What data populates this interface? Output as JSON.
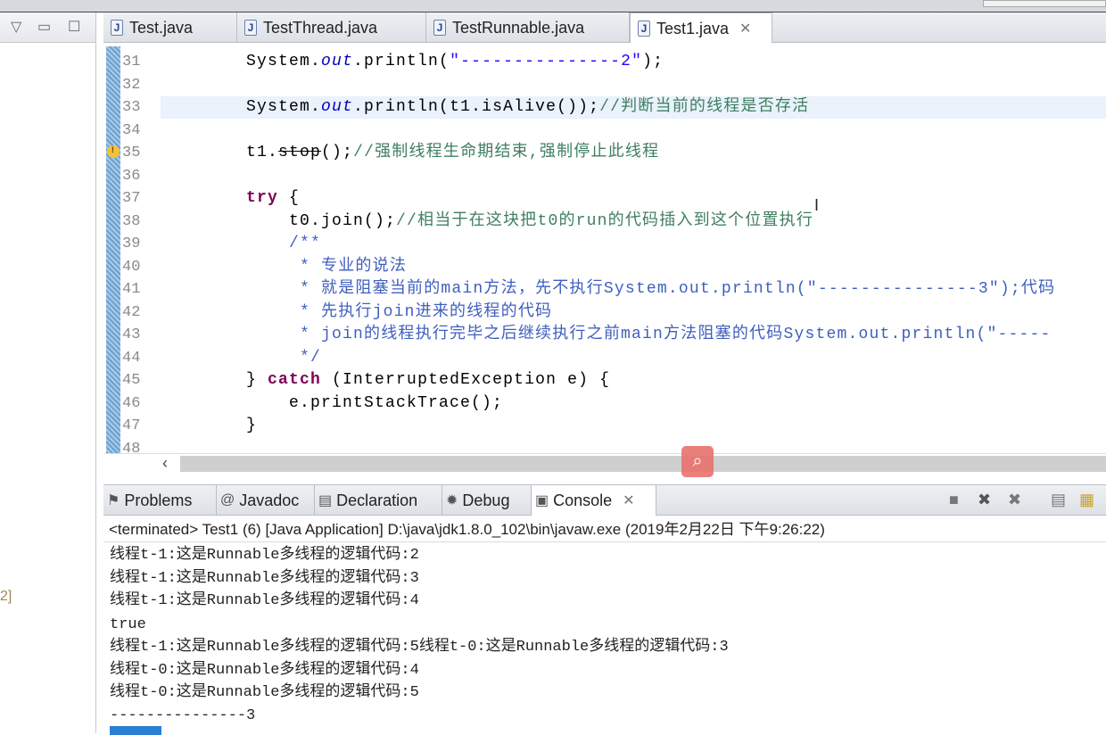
{
  "tabs": [
    {
      "label": "Test.java"
    },
    {
      "label": "TestThread.java"
    },
    {
      "label": "TestRunnable.java"
    },
    {
      "label": "Test1.java",
      "active": true
    }
  ],
  "left_panel": {
    "hint": "2]"
  },
  "editor": {
    "lines": [
      {
        "n": "31",
        "segs": [
          {
            "t": "        System.",
            "c": ""
          },
          {
            "t": "out",
            "c": "fld"
          },
          {
            "t": ".println(",
            "c": ""
          },
          {
            "t": "\"---------------2\"",
            "c": "str"
          },
          {
            "t": ");",
            "c": ""
          }
        ]
      },
      {
        "n": "32",
        "segs": []
      },
      {
        "n": "33",
        "hl": true,
        "segs": [
          {
            "t": "        System.",
            "c": ""
          },
          {
            "t": "out",
            "c": "fld"
          },
          {
            "t": ".println(t1.isAlive());",
            "c": ""
          },
          {
            "t": "//判断当前的线程是否存活",
            "c": "cmt"
          }
        ]
      },
      {
        "n": "34",
        "segs": []
      },
      {
        "n": "35",
        "warn": true,
        "segs": [
          {
            "t": "        t1.",
            "c": ""
          },
          {
            "t": "stop",
            "c": "dep"
          },
          {
            "t": "();",
            "c": ""
          },
          {
            "t": "//强制线程生命期结束,强制停止此线程",
            "c": "cmt"
          }
        ]
      },
      {
        "n": "36",
        "segs": []
      },
      {
        "n": "37",
        "segs": [
          {
            "t": "        ",
            "c": ""
          },
          {
            "t": "try",
            "c": "kw"
          },
          {
            "t": " {",
            "c": ""
          }
        ]
      },
      {
        "n": "38",
        "segs": [
          {
            "t": "            t0.join();",
            "c": ""
          },
          {
            "t": "//相当于在这块把t0的run的代码插入到这个位置执行",
            "c": "cmt"
          }
        ]
      },
      {
        "n": "39",
        "segs": [
          {
            "t": "            /**",
            "c": "jd"
          }
        ]
      },
      {
        "n": "40",
        "segs": [
          {
            "t": "             * 专业的说法",
            "c": "jd"
          }
        ]
      },
      {
        "n": "41",
        "segs": [
          {
            "t": "             * 就是阻塞当前的main方法，先不执行System.out.println(\"---------------3\");代码",
            "c": "jd"
          }
        ]
      },
      {
        "n": "42",
        "segs": [
          {
            "t": "             * 先执行join进来的线程的代码",
            "c": "jd"
          }
        ]
      },
      {
        "n": "43",
        "segs": [
          {
            "t": "             * join的线程执行完毕之后继续执行之前main方法阻塞的代码System.out.println(\"-----",
            "c": "jd"
          }
        ]
      },
      {
        "n": "44",
        "segs": [
          {
            "t": "             */",
            "c": "jd"
          }
        ]
      },
      {
        "n": "45",
        "segs": [
          {
            "t": "        } ",
            "c": ""
          },
          {
            "t": "catch",
            "c": "kw"
          },
          {
            "t": " (InterruptedException e) {",
            "c": ""
          }
        ]
      },
      {
        "n": "46",
        "segs": [
          {
            "t": "            e.printStackTrace();",
            "c": ""
          }
        ]
      },
      {
        "n": "47",
        "segs": [
          {
            "t": "        }",
            "c": ""
          }
        ]
      },
      {
        "n": "48",
        "segs": []
      }
    ]
  },
  "panel_tabs": [
    {
      "label": "Problems",
      "icon": "problems-icon",
      "glyph": "⚑"
    },
    {
      "label": "Javadoc",
      "icon": "javadoc-icon",
      "glyph": "@"
    },
    {
      "label": "Declaration",
      "icon": "declaration-icon",
      "glyph": "▤"
    },
    {
      "label": "Debug",
      "icon": "debug-icon",
      "glyph": "✹"
    },
    {
      "label": "Console",
      "icon": "console-icon",
      "glyph": "▣",
      "active": true
    }
  ],
  "console": {
    "info": "<terminated> Test1 (6) [Java Application] D:\\java\\jdk1.8.0_102\\bin\\javaw.exe (2019年2月22日 下午9:26:22)",
    "lines": [
      "线程t-1:这是Runnable多线程的逻辑代码:2",
      "线程t-1:这是Runnable多线程的逻辑代码:3",
      "线程t-1:这是Runnable多线程的逻辑代码:4",
      "true",
      "线程t-1:这是Runnable多线程的逻辑代码:5线程t-0:这是Runnable多线程的逻辑代码:3",
      "线程t-0:这是Runnable多线程的逻辑代码:4",
      "线程t-0:这是Runnable多线程的逻辑代码:5",
      "---------------3"
    ]
  }
}
